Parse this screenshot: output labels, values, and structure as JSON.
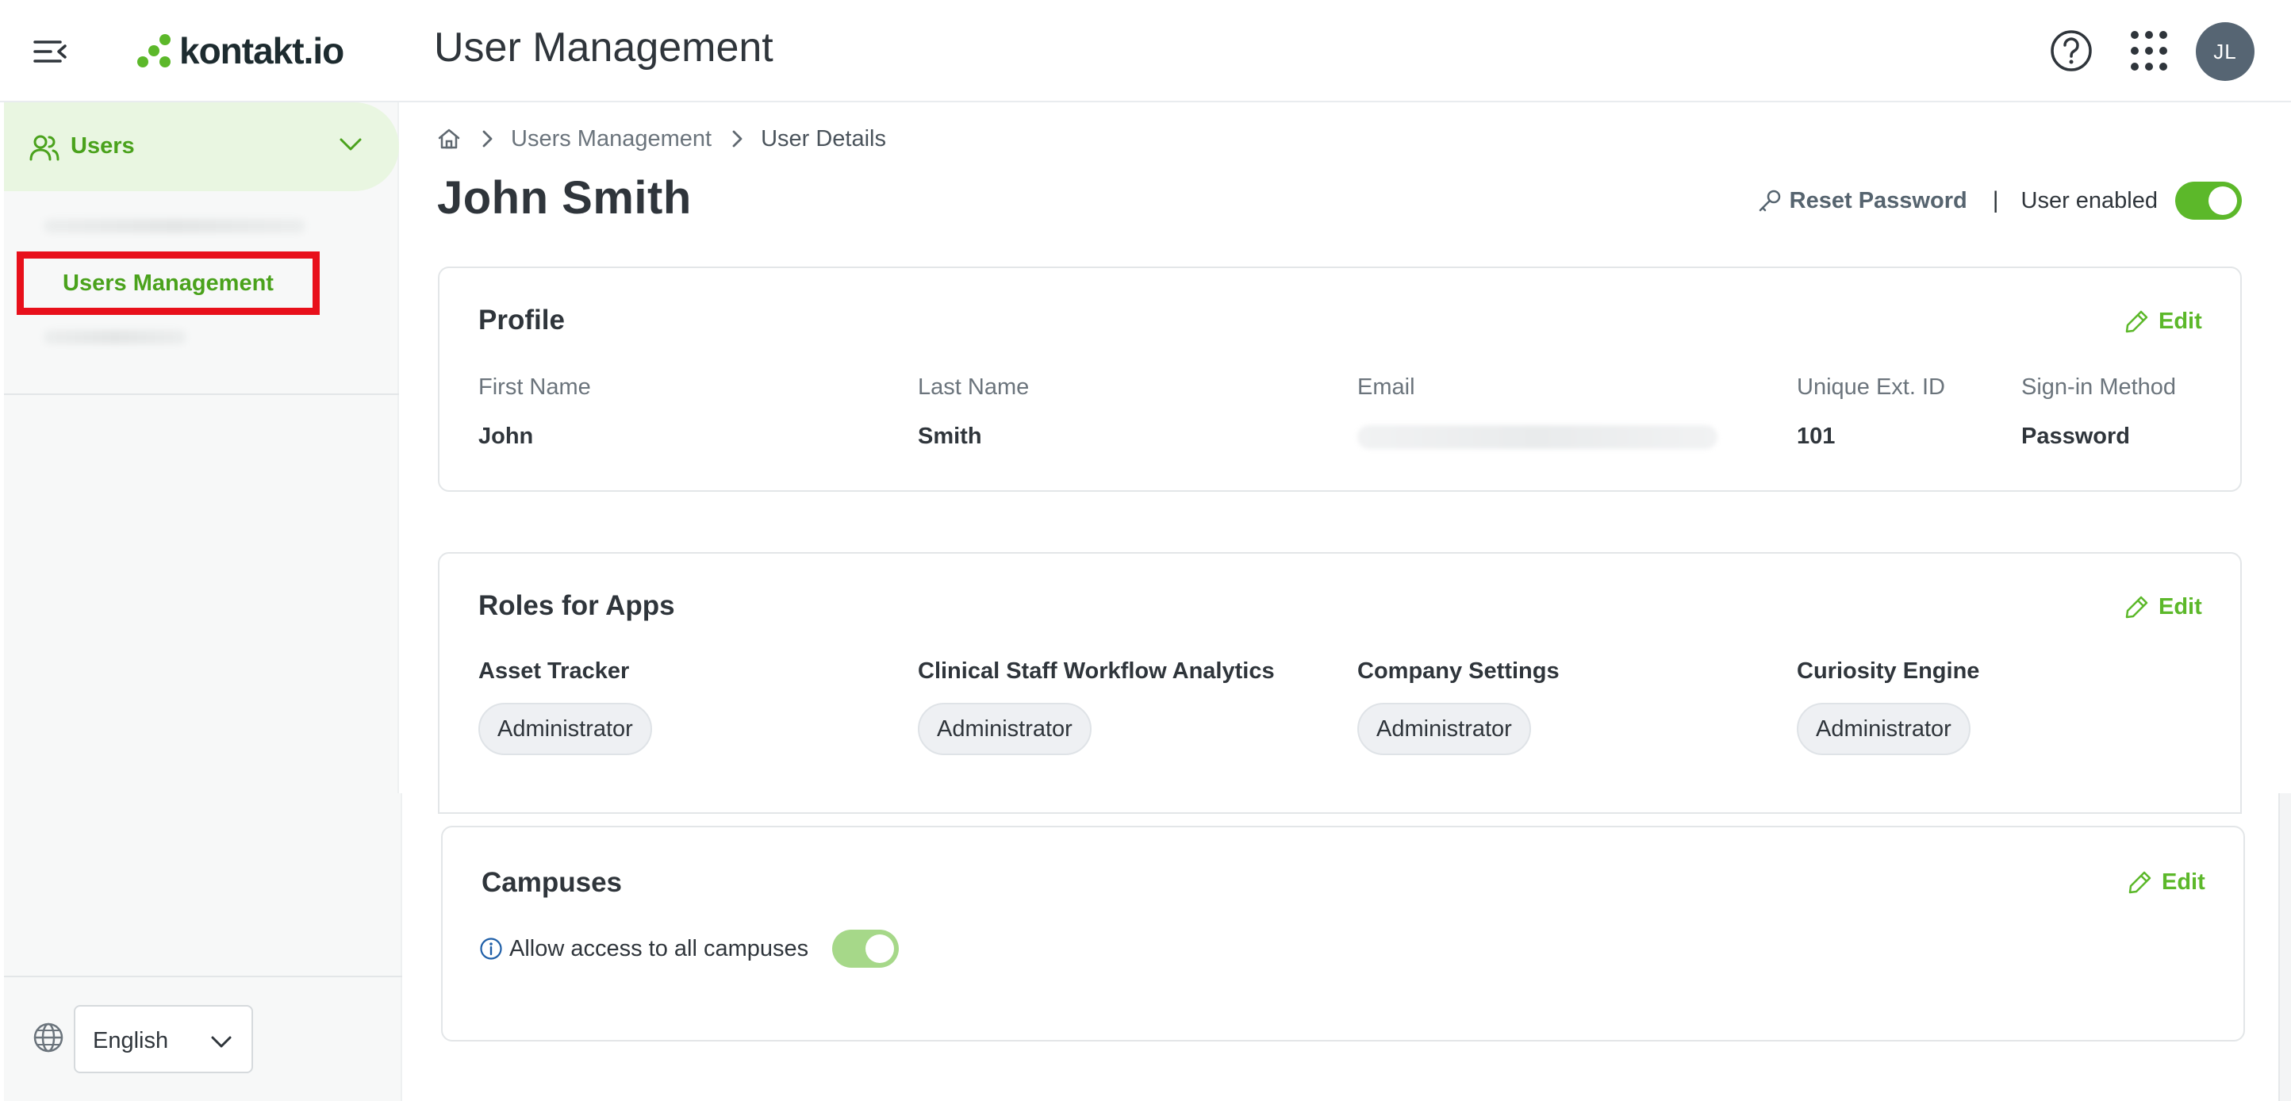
{
  "header": {
    "logo_text": "kontakt.io",
    "app_title": "User Management",
    "avatar_initials": "JL",
    "accent_color": "#5cb82a"
  },
  "sidebar": {
    "group_label": "Users",
    "active_item": "Users Management",
    "language": "English"
  },
  "breadcrumb": {
    "items": [
      "Users Management",
      "User Details"
    ]
  },
  "page": {
    "title": "John Smith",
    "reset_password": "Reset Password",
    "separator": "|",
    "user_enabled_label": "User enabled",
    "user_enabled": true
  },
  "profile": {
    "title": "Profile",
    "edit_label": "Edit",
    "fields": [
      {
        "label": "First Name",
        "value": "John"
      },
      {
        "label": "Last Name",
        "value": "Smith"
      },
      {
        "label": "Email",
        "value": ""
      },
      {
        "label": "Unique Ext. ID",
        "value": "101"
      },
      {
        "label": "Sign-in Method",
        "value": "Password"
      }
    ]
  },
  "roles": {
    "title": "Roles for Apps",
    "edit_label": "Edit",
    "apps": [
      {
        "name": "Asset Tracker",
        "role": "Administrator"
      },
      {
        "name": "Clinical Staff Workflow Analytics",
        "role": "Administrator"
      },
      {
        "name": "Company Settings",
        "role": "Administrator"
      },
      {
        "name": "Curiosity Engine",
        "role": "Administrator"
      }
    ]
  },
  "campuses": {
    "title": "Campuses",
    "edit_label": "Edit",
    "allow_all_label": "Allow access to all campuses",
    "allow_all": true
  }
}
